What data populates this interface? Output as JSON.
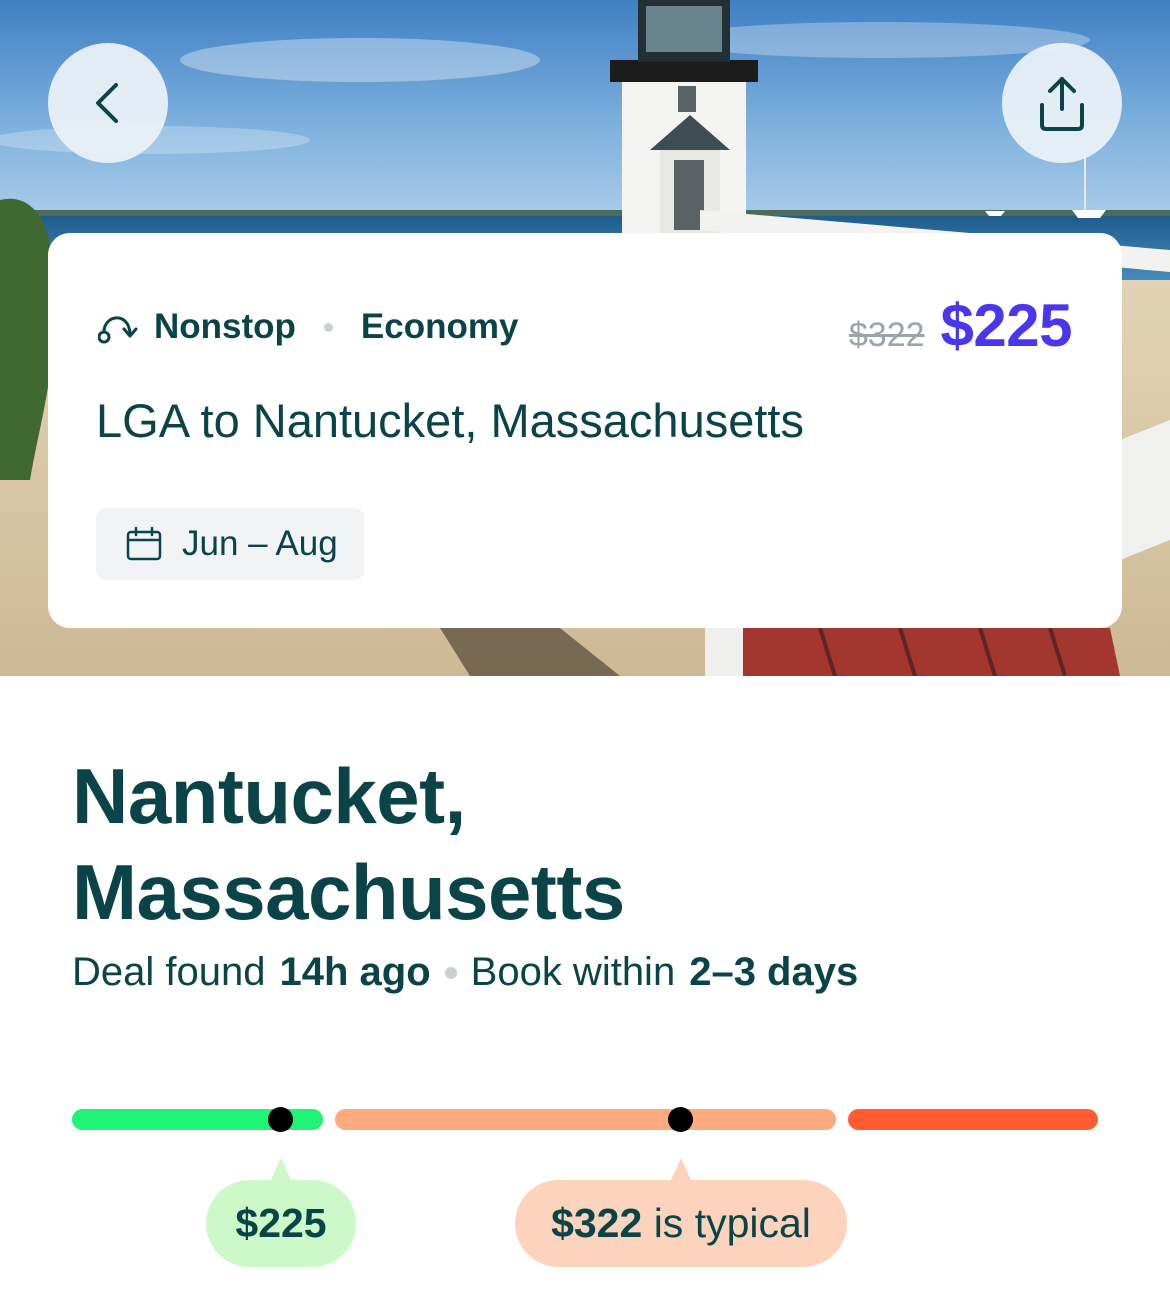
{
  "header": {
    "back_icon": "chevron-left-icon",
    "share_icon": "share-icon"
  },
  "card": {
    "route_icon": "route-icon",
    "stops": "Nonstop",
    "cabin": "Economy",
    "old_price": "$322",
    "price": "$225",
    "route": "LGA to Nantucket, Massachusetts",
    "calendar_icon": "calendar-icon",
    "dates": "Jun – Aug"
  },
  "main": {
    "title_line1": "Nantucket,",
    "title_line2": "Massachusetts",
    "deal_found_label": "Deal found",
    "deal_found_value": "14h ago",
    "book_within_label": "Book within",
    "book_within_value": "2–3 days"
  },
  "price_range": {
    "deal_price": "$225",
    "typical_price": "$322",
    "typical_suffix": "is typical",
    "colors": {
      "low": "#1ff477",
      "typical": "#fdaa7f",
      "high": "#ff5d2f"
    }
  },
  "colors": {
    "accent": "#4936ee",
    "text": "#0b4448"
  }
}
